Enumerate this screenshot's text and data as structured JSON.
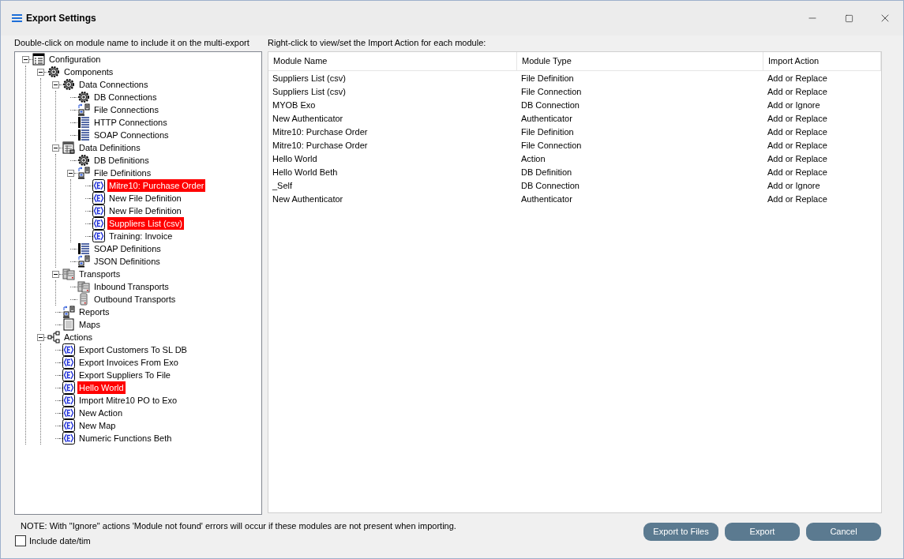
{
  "window": {
    "title": "Export Settings"
  },
  "tree": {
    "hint": "Double-click on module name to include it on the multi-export",
    "items": [
      {
        "label": "Configuration",
        "kind": "config",
        "selected": false,
        "expanded": true,
        "children": [
          {
            "label": "Components",
            "kind": "gear",
            "selected": false,
            "expanded": true,
            "children": [
              {
                "label": "Data Connections",
                "kind": "gear",
                "selected": false,
                "expanded": true,
                "children": [
                  {
                    "label": "DB Connections",
                    "kind": "gear",
                    "selected": false
                  },
                  {
                    "label": "File Connections",
                    "kind": "pc",
                    "selected": false
                  },
                  {
                    "label": "HTTP Connections",
                    "kind": "list",
                    "selected": false
                  },
                  {
                    "label": "SOAP Connections",
                    "kind": "list",
                    "selected": false
                  }
                ]
              },
              {
                "label": "Data Definitions",
                "kind": "defs",
                "selected": false,
                "expanded": true,
                "children": [
                  {
                    "label": "DB Definitions",
                    "kind": "gear",
                    "selected": false
                  },
                  {
                    "label": "File Definitions",
                    "kind": "pc",
                    "selected": false,
                    "expanded": true,
                    "children": [
                      {
                        "label": "Mitre10: Purchase Order",
                        "kind": "module",
                        "selected": true
                      },
                      {
                        "label": "New File Definition",
                        "kind": "module",
                        "selected": false
                      },
                      {
                        "label": "New File Definition",
                        "kind": "module",
                        "selected": false
                      },
                      {
                        "label": "Suppliers List (csv)",
                        "kind": "module",
                        "selected": true
                      },
                      {
                        "label": "Training: Invoice",
                        "kind": "module",
                        "selected": false
                      }
                    ]
                  },
                  {
                    "label": "SOAP Definitions",
                    "kind": "list",
                    "selected": false
                  },
                  {
                    "label": "JSON Definitions",
                    "kind": "pc",
                    "selected": false
                  }
                ]
              },
              {
                "label": "Transports",
                "kind": "servers",
                "selected": false,
                "expanded": true,
                "children": [
                  {
                    "label": "Inbound Transports",
                    "kind": "servers",
                    "selected": false
                  },
                  {
                    "label": "Outbound Transports",
                    "kind": "server",
                    "selected": false
                  }
                ]
              },
              {
                "label": "Reports",
                "kind": "pc",
                "selected": false
              },
              {
                "label": "Maps",
                "kind": "doc",
                "selected": false
              }
            ]
          },
          {
            "label": "Actions",
            "kind": "network",
            "selected": false,
            "expanded": true,
            "children": [
              {
                "label": "Export Customers To SL DB",
                "kind": "module",
                "selected": false
              },
              {
                "label": "Export Invoices From Exo",
                "kind": "module",
                "selected": false
              },
              {
                "label": "Export Suppliers To File",
                "kind": "module",
                "selected": false
              },
              {
                "label": "Hello World",
                "kind": "module",
                "selected": true
              },
              {
                "label": "Import Mitre10 PO to Exo",
                "kind": "module",
                "selected": false
              },
              {
                "label": "New Action",
                "kind": "module",
                "selected": false
              },
              {
                "label": "New Map",
                "kind": "module",
                "selected": false
              },
              {
                "label": "Numeric Functions Beth",
                "kind": "module",
                "selected": false
              }
            ]
          }
        ]
      }
    ]
  },
  "table": {
    "hint": "Right-click to view/set the Import Action for each module:",
    "columns": [
      "Module Name",
      "Module Type",
      "Import Action"
    ],
    "rows": [
      [
        "Suppliers List (csv)",
        "File Definition",
        "Add or Replace"
      ],
      [
        "Suppliers List (csv)",
        "File Connection",
        "Add or Replace"
      ],
      [
        "MYOB Exo",
        "DB Connection",
        "Add or Ignore"
      ],
      [
        "New Authenticator",
        "Authenticator",
        "Add or Replace"
      ],
      [
        "Mitre10: Purchase Order",
        "File Definition",
        "Add or Replace"
      ],
      [
        "Mitre10: Purchase Order",
        "File Connection",
        "Add or Replace"
      ],
      [
        "Hello World",
        "Action",
        "Add or Replace"
      ],
      [
        "Hello World Beth",
        "DB Definition",
        "Add or Replace"
      ],
      [
        "_Self",
        "DB Connection",
        "Add or Ignore"
      ],
      [
        "New Authenticator",
        "Authenticator",
        "Add or Replace"
      ]
    ]
  },
  "note": "NOTE: With \"Ignore\" actions 'Module not found' errors will occur if these modules are not present when importing.",
  "include_date": {
    "label": "Include date/tim",
    "checked": false
  },
  "buttons": [
    "Export to Files",
    "Export",
    "Cancel"
  ]
}
